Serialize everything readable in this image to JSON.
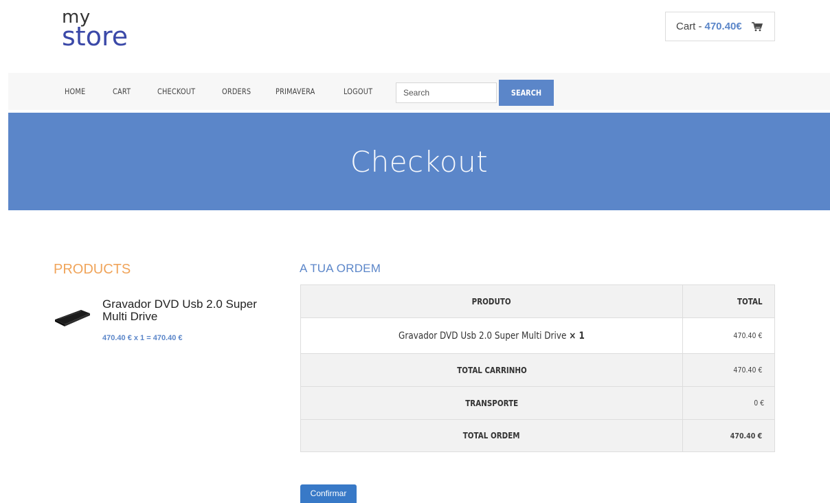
{
  "logo": {
    "line1": "my",
    "line2": "store"
  },
  "cart": {
    "label": "Cart - ",
    "amount": "470.40€"
  },
  "nav": {
    "items": [
      "HOME",
      "CART",
      "CHECKOUT",
      "ORDERS",
      "PRIMAVERA",
      "LOGOUT"
    ],
    "search_placeholder": "Search",
    "search_button": "SEARCH"
  },
  "banner": {
    "title": "Checkout"
  },
  "products": {
    "title": "PRODUCTS",
    "items": [
      {
        "name": "Gravador DVD Usb 2.0 Super Multi Drive",
        "price_line": "470.40 € x 1 = 470.40 €"
      }
    ]
  },
  "order": {
    "title": "A TUA ORDEM",
    "headers": {
      "product": "PRODUTO",
      "total": "TOTAL"
    },
    "item": {
      "name": "Gravador DVD Usb 2.0 Super Multi Drive",
      "qty": "× 1",
      "total": "470.40 €"
    },
    "rows": [
      {
        "label": "TOTAL CARRINHO",
        "value": "470.40 €"
      },
      {
        "label": "TRANSPORTE",
        "value": "0 €"
      },
      {
        "label": "TOTAL ORDEM",
        "value": "470.40 €"
      }
    ]
  },
  "confirm_button": "Confirmar",
  "colors": {
    "accent": "#5b86c9",
    "products_title": "#f0a45a",
    "logo_store": "#3b49a8",
    "confirm": "#3879c7"
  },
  "icons": {
    "cart": "cart-icon"
  }
}
